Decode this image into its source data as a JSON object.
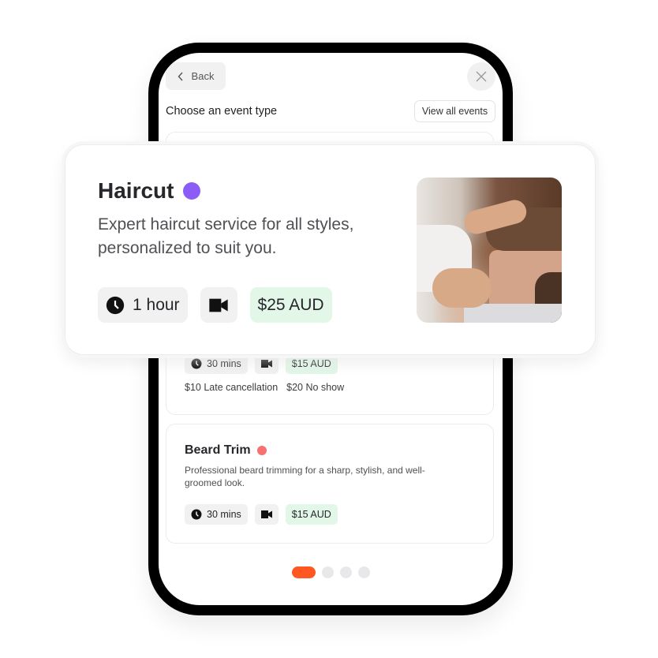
{
  "header": {
    "back_label": "Back",
    "close_icon": "close-icon",
    "section_title": "Choose an event type",
    "view_all_label": "View all events"
  },
  "featured_event": {
    "title": "Haircut",
    "color": "#8b5cf6",
    "description": "Expert haircut service for all styles, personalized to suit you.",
    "duration": "1 hour",
    "location_icon": "video-camera-icon",
    "price": "$25 AUD",
    "image_alt": "Barber cutting a man's hair"
  },
  "events": [
    {
      "duration": "30 mins",
      "price": "$15 AUD",
      "late_cancellation": "$10 Late cancellation",
      "no_show": "$20 No show"
    },
    {
      "title": "Beard Trim",
      "color": "#f87171",
      "description": "Professional beard trimming for a sharp, stylish, and well-groomed look.",
      "duration": "30 mins",
      "price": "$15 AUD"
    }
  ],
  "pagination": {
    "total": 4,
    "active_index": 0,
    "active_color": "#ff5722"
  }
}
